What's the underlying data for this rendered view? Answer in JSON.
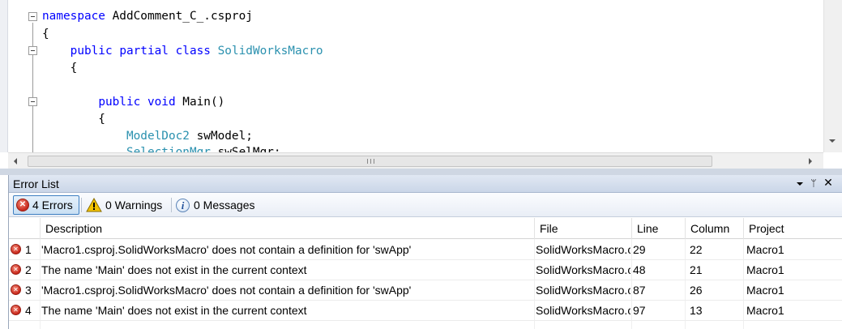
{
  "editor": {
    "lines": [
      {
        "parts": [
          {
            "t": "namespace",
            "c": "kw"
          },
          {
            "t": " AddComment_C_.csproj",
            "c": ""
          }
        ]
      },
      {
        "parts": [
          {
            "t": "{",
            "c": ""
          }
        ]
      },
      {
        "parts": [
          {
            "t": "    ",
            "c": ""
          },
          {
            "t": "public",
            "c": "kw"
          },
          {
            "t": " ",
            "c": ""
          },
          {
            "t": "partial",
            "c": "kw"
          },
          {
            "t": " ",
            "c": ""
          },
          {
            "t": "class",
            "c": "kw"
          },
          {
            "t": " ",
            "c": ""
          },
          {
            "t": "SolidWorksMacro",
            "c": "ty"
          }
        ]
      },
      {
        "parts": [
          {
            "t": "    {",
            "c": ""
          }
        ]
      },
      {
        "parts": [
          {
            "t": "",
            "c": ""
          }
        ]
      },
      {
        "parts": [
          {
            "t": "        ",
            "c": ""
          },
          {
            "t": "public",
            "c": "kw"
          },
          {
            "t": " ",
            "c": ""
          },
          {
            "t": "void",
            "c": "kw"
          },
          {
            "t": " Main()",
            "c": ""
          }
        ]
      },
      {
        "parts": [
          {
            "t": "        {",
            "c": ""
          }
        ]
      },
      {
        "parts": [
          {
            "t": "            ",
            "c": ""
          },
          {
            "t": "ModelDoc2",
            "c": "ty"
          },
          {
            "t": " swModel;",
            "c": ""
          }
        ]
      },
      {
        "parts": [
          {
            "t": "            ",
            "c": ""
          },
          {
            "t": "SelectionMgr",
            "c": "ty"
          },
          {
            "t": " swSelMgr;",
            "c": ""
          }
        ]
      }
    ]
  },
  "error_panel": {
    "title": "Error List",
    "pin_glyph": "ᛘ",
    "close_glyph": "✕",
    "filters": {
      "errors": {
        "label": "4 Errors",
        "icon": "error-icon",
        "color": "#c8281c"
      },
      "warnings": {
        "label": "0 Warnings",
        "icon": "warning-icon",
        "color": "#f2c200"
      },
      "messages": {
        "label": "0 Messages",
        "icon": "info-icon",
        "color": "#1f4f9a"
      }
    },
    "columns": {
      "description": "Description",
      "file": "File",
      "line": "Line",
      "column": "Column",
      "project": "Project"
    },
    "rows": [
      {
        "num": "1",
        "description": "'Macro1.csproj.SolidWorksMacro' does not contain a definition for 'swApp'",
        "file": "SolidWorksMacro.cs",
        "line": "29",
        "column": "22",
        "project": "Macro1"
      },
      {
        "num": "2",
        "description": "The name 'Main' does not exist in the current context",
        "file": "SolidWorksMacro.cs",
        "line": "48",
        "column": "21",
        "project": "Macro1"
      },
      {
        "num": "3",
        "description": "'Macro1.csproj.SolidWorksMacro' does not contain a definition for 'swApp'",
        "file": "SolidWorksMacro.cs",
        "line": "87",
        "column": "26",
        "project": "Macro1"
      },
      {
        "num": "4",
        "description": "The name 'Main' does not exist in the current context",
        "file": "SolidWorksMacro.cs",
        "line": "97",
        "column": "13",
        "project": "Macro1"
      }
    ]
  }
}
